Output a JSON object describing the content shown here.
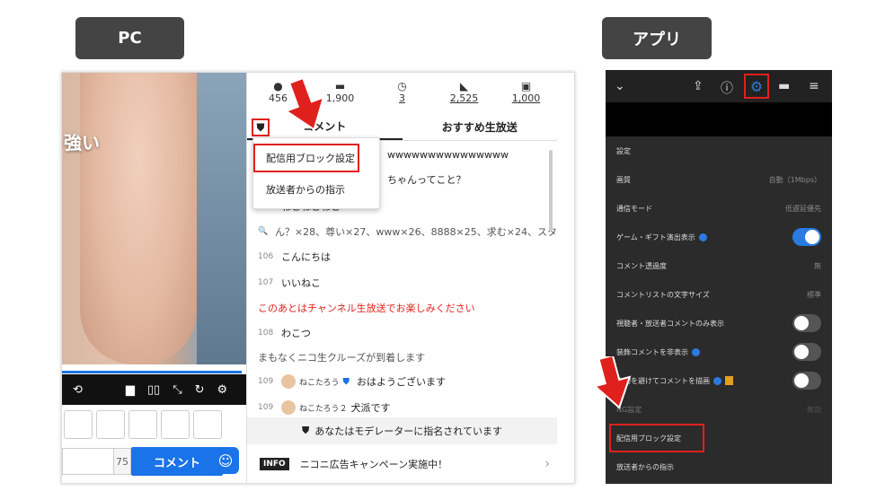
{
  "labels": {
    "pc": "PC",
    "app": "アプリ"
  },
  "colors": {
    "accent": "#1a73e8",
    "highlight": "#e0201d",
    "app_bg": "#2b2b2b"
  },
  "pc": {
    "video_caption": "強い",
    "comment_count": "75",
    "comment_button": "コメント",
    "stats": [
      {
        "icon": "person-icon",
        "value": "456"
      },
      {
        "icon": "comment-icon",
        "value": "1,900"
      },
      {
        "icon": "clock-icon",
        "value": "3"
      },
      {
        "icon": "ad-icon",
        "value": "2,525"
      },
      {
        "icon": "gift-icon",
        "value": "1,000"
      }
    ],
    "tabs": {
      "comment": "コメント",
      "recommended": "おすすめ生放送"
    },
    "menu": {
      "block_settings": "配信用ブロック設定",
      "broadcaster_instruction": "放送者からの指示"
    },
    "comments": {
      "c1": "wwwwwwwwwwwwwww",
      "c2": "ちゃんってこと？",
      "c3_num": "105",
      "c3": "ねこねこねこ",
      "summary": "ん？×28、尊い×27、www×26、8888×25、求む×24、スタ",
      "c106_num": "106",
      "c106": "こんにちは",
      "c107_num": "107",
      "c107": "いいねこ",
      "red": "このあとはチャンネル生放送でお楽しみください",
      "c108_num": "108",
      "c108": "わこつ",
      "cruise": "まもなくニコ生クルーズが到着します",
      "c109_num": "109",
      "c109_user": "ねこたろう",
      "c109": "おはようございます",
      "c109b_num": "109",
      "c109b_user": "ねこたろう２",
      "c109b": "犬派です"
    },
    "moderator": "あなたはモデレーターに指名されています",
    "info_badge": "INFO",
    "info_text": "ニコニ広告キャンペーン実施中！"
  },
  "app": {
    "section_title": "設定",
    "rows": {
      "quality_label": "画質",
      "quality_value": "自動（1Mbps）",
      "mode_label": "通信モード",
      "mode_value": "低遅延優先",
      "gift_label": "ゲーム・ギフト演出表示",
      "opacity_label": "コメント透過度",
      "opacity_value": "無",
      "fontsize_label": "コメントリストの文字サイズ",
      "fontsize_value": "標準",
      "viewer_only_label": "視聴者・放送者コメントのみ表示",
      "deco_label": "装飾コメントを非表示",
      "avoid_label": "人物を避けてコメントを描画",
      "ng_label": "NG設定",
      "ng_value": "無効",
      "block_label": "配信用ブロック設定",
      "instruction_label": "放送者からの指示"
    }
  }
}
